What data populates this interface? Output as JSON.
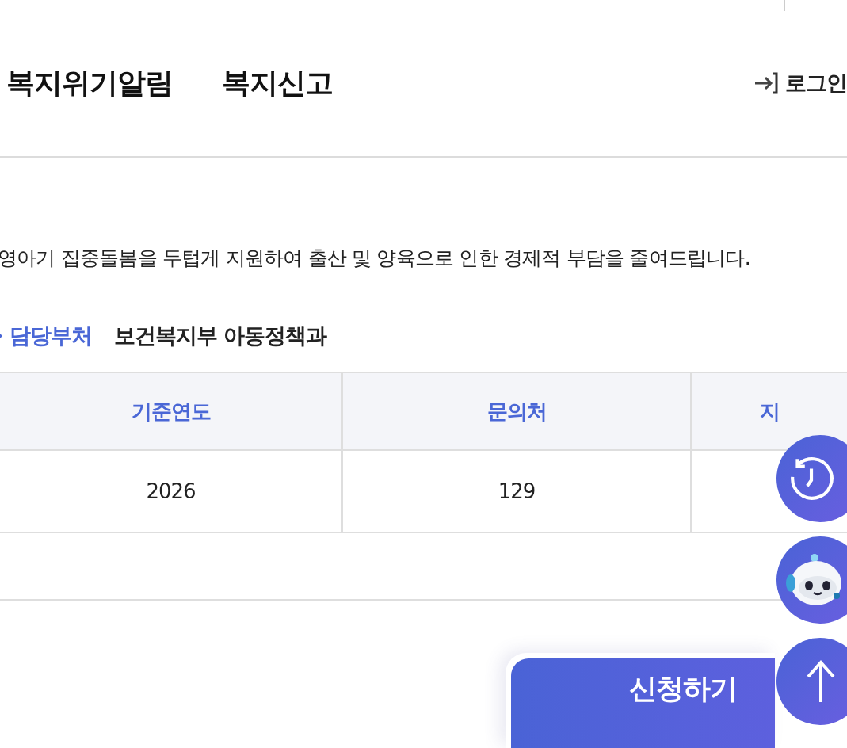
{
  "nav": {
    "items": [
      {
        "label": "복지위기알림"
      },
      {
        "label": "복지신고"
      }
    ],
    "login": "로그인"
  },
  "summary": "영아기 집중돌봄을 두텁게 지원하여 출산 및 양육으로 인한 경제적 부담을 줄여드립니다.",
  "department": {
    "label": "담당부처",
    "value": "보건복지부 아동정책과"
  },
  "table": {
    "columns": [
      "기준연도",
      "문의처",
      "지"
    ],
    "rows": [
      [
        "2026",
        "129"
      ]
    ]
  },
  "apply": "신청하기"
}
